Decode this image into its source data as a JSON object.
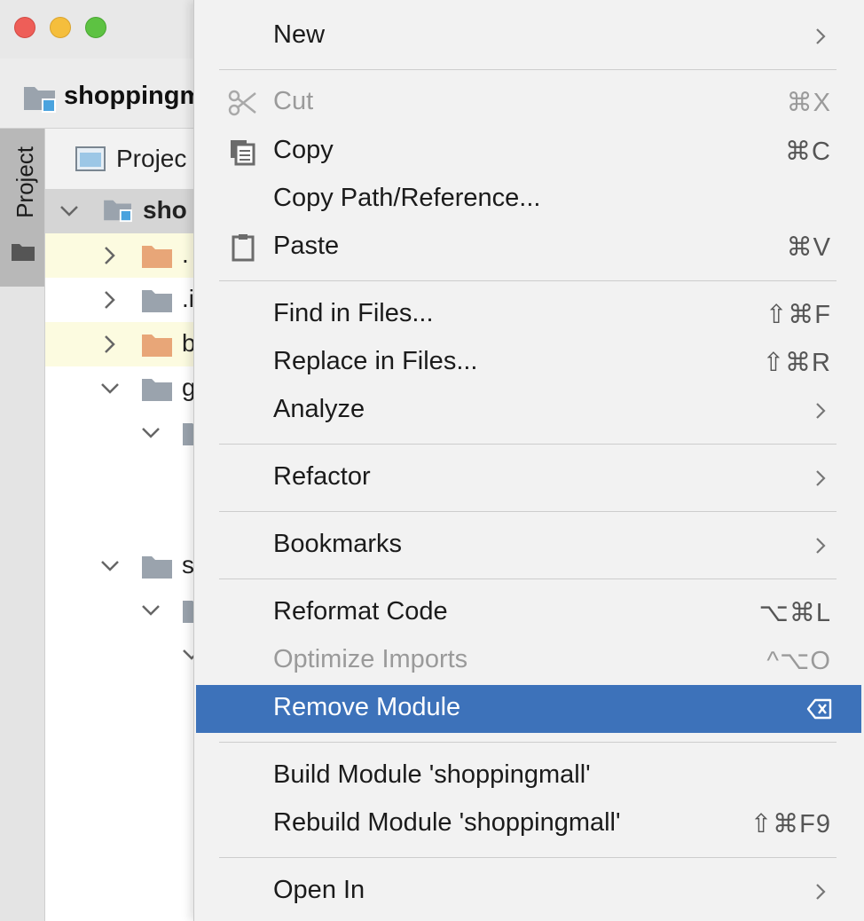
{
  "window": {
    "project_name": "shoppingmall",
    "nav_title": "shoppingm"
  },
  "tool_window": {
    "side_label": "Project",
    "panel_title": "Projec"
  },
  "tree": [
    {
      "label": "sho",
      "bold": true,
      "state": "expanded"
    },
    {
      "label": ".",
      "bold": false,
      "state": "collapsed"
    },
    {
      "label": ".i",
      "bold": false,
      "state": "collapsed"
    },
    {
      "label": "b",
      "bold": false,
      "state": "collapsed"
    },
    {
      "label": "g",
      "bold": false,
      "state": "expanded"
    },
    {
      "label": "",
      "bold": false,
      "state": "expanded"
    },
    {
      "label": "s",
      "bold": false,
      "state": "expanded"
    },
    {
      "label": "",
      "bold": false,
      "state": "expanded"
    }
  ],
  "menu": {
    "items": [
      {
        "label": "New",
        "shortcut": "",
        "submenu": true
      },
      {
        "label": "Cut",
        "shortcut": "⌘X",
        "disabled": true,
        "icon": "scissors-icon"
      },
      {
        "label": "Copy",
        "shortcut": "⌘C",
        "icon": "copy-icon"
      },
      {
        "label": "Copy Path/Reference...",
        "shortcut": ""
      },
      {
        "label": "Paste",
        "shortcut": "⌘V",
        "icon": "clipboard-icon"
      },
      {
        "label": "Find in Files...",
        "shortcut": "⇧⌘F"
      },
      {
        "label": "Replace in Files...",
        "shortcut": "⇧⌘R"
      },
      {
        "label": "Analyze",
        "shortcut": "",
        "submenu": true
      },
      {
        "label": "Refactor",
        "shortcut": "",
        "submenu": true
      },
      {
        "label": "Bookmarks",
        "shortcut": "",
        "submenu": true
      },
      {
        "label": "Reformat Code",
        "shortcut": "⌥⌘L"
      },
      {
        "label": "Optimize Imports",
        "shortcut": "^⌥O",
        "disabled": true
      },
      {
        "label": "Remove Module",
        "shortcut": "",
        "highlighted": true,
        "icon": "delete-key-icon"
      },
      {
        "label": "Build Module 'shoppingmall'",
        "shortcut": ""
      },
      {
        "label": "Rebuild Module 'shoppingmall'",
        "shortcut": "⇧⌘F9"
      },
      {
        "label": "Open In",
        "shortcut": "",
        "submenu": true
      }
    ]
  },
  "colors": {
    "highlight": "#3d72ba",
    "menu_bg": "#f2f2f2",
    "folder_orange": "#e8a678",
    "folder_gray": "#9aa3ad",
    "module_blue": "#4aa3de"
  }
}
